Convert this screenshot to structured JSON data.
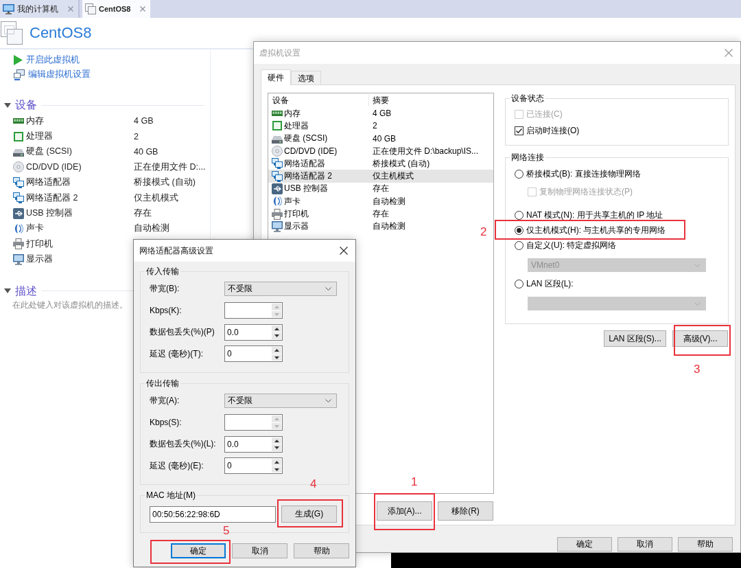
{
  "main_tabs": [
    {
      "kind": "computer",
      "label": "我的计算机",
      "selected": false
    },
    {
      "kind": "vm",
      "label": "CentOS8",
      "selected": true
    }
  ],
  "vm_page": {
    "title": "CentOS8",
    "actions": [
      {
        "kind": "power_on",
        "label": "开启此虚拟机"
      },
      {
        "kind": "edit",
        "label": "编辑虚拟机设置"
      }
    ],
    "devices": {
      "title": "设备",
      "expanded": true,
      "items": [
        {
          "kind": "memory",
          "name": "内存",
          "summary": "4 GB"
        },
        {
          "kind": "processor",
          "name": "处理器",
          "summary": "2"
        },
        {
          "kind": "disk",
          "name": "硬盘 (SCSI)",
          "summary": "40 GB"
        },
        {
          "kind": "cdrom",
          "name": "CD/DVD (IDE)",
          "summary": "正在使用文件 D:..."
        },
        {
          "kind": "network",
          "name": "网络适配器",
          "summary": "桥接模式 (自动)"
        },
        {
          "kind": "network",
          "name": "网络适配器 2",
          "summary": "仅主机模式"
        },
        {
          "kind": "usb",
          "name": "USB 控制器",
          "summary": "存在"
        },
        {
          "kind": "sound",
          "name": "声卡",
          "summary": "自动检测"
        },
        {
          "kind": "printer",
          "name": "打印机"
        },
        {
          "kind": "display",
          "name": "显示器"
        }
      ]
    },
    "description": {
      "title": "描述",
      "expanded": true,
      "text": "在此处键入对该虚拟机的描述。"
    }
  },
  "settings_dialog": {
    "title": "虚拟机设置",
    "active": false,
    "tabs": [
      {
        "label": "硬件",
        "selected": true
      },
      {
        "label": "选项",
        "selected": false
      }
    ],
    "device_table": {
      "columns": [
        "设备",
        "摘要"
      ],
      "rows": [
        {
          "kind": "memory",
          "device": "内存",
          "summary": "4 GB",
          "selected": false
        },
        {
          "kind": "processor",
          "device": "处理器",
          "summary": "2",
          "selected": false
        },
        {
          "kind": "disk",
          "device": "硬盘 (SCSI)",
          "summary": "40 GB",
          "selected": false
        },
        {
          "kind": "cdrom",
          "device": "CD/DVD (IDE)",
          "summary": "正在使用文件 D:\\backup\\IS...",
          "selected": false
        },
        {
          "kind": "network",
          "device": "网络适配器",
          "summary": "桥接模式 (自动)",
          "selected": false
        },
        {
          "kind": "network",
          "device": "网络适配器 2",
          "summary": "仅主机模式",
          "selected": true
        },
        {
          "kind": "usb",
          "device": "USB 控制器",
          "summary": "存在",
          "selected": false
        },
        {
          "kind": "sound",
          "device": "声卡",
          "summary": "自动检测",
          "selected": false
        },
        {
          "kind": "printer",
          "device": "打印机",
          "summary": "存在",
          "selected": false
        },
        {
          "kind": "display",
          "device": "显示器",
          "summary": "自动检测",
          "selected": false
        }
      ]
    },
    "table_buttons": [
      {
        "label": "添加(A)...",
        "annotation": "1"
      },
      {
        "label": "移除(R)"
      }
    ],
    "device_status": {
      "title": "设备状态",
      "options": [
        {
          "label": "已连接(C)",
          "checked": false,
          "disabled": true
        },
        {
          "label": "启动时连接(O)",
          "checked": true,
          "disabled": false
        }
      ]
    },
    "network_connection": {
      "title": "网络连接",
      "options": [
        {
          "kind": "radio",
          "label": "桥接模式(B): 直接连接物理网络",
          "selected": false,
          "disabled": false
        },
        {
          "kind": "checkbox",
          "label": "复制物理网络连接状态(P)",
          "checked": false,
          "disabled": true
        },
        {
          "kind": "radio",
          "label": "NAT 模式(N): 用于共享主机的 IP 地址",
          "selected": false,
          "disabled": false
        },
        {
          "kind": "radio",
          "label": "仅主机模式(H): 与主机共享的专用网络",
          "selected": true,
          "disabled": false,
          "annotation": "2"
        },
        {
          "kind": "radio",
          "label": "自定义(U): 特定虚拟网络",
          "selected": false,
          "disabled": false
        },
        {
          "kind": "dropdown",
          "value": "VMnet0",
          "disabled": true
        },
        {
          "kind": "radio",
          "label": "LAN 区段(L):",
          "selected": false,
          "disabled": false
        },
        {
          "kind": "dropdown",
          "disabled": true
        }
      ]
    },
    "network_buttons": [
      {
        "label": "LAN 区段(S)..."
      },
      {
        "label": "高级(V)...",
        "annotation": "3"
      }
    ],
    "buttons": [
      {
        "label": "确定"
      },
      {
        "label": "取消"
      },
      {
        "label": "帮助"
      }
    ]
  },
  "advanced_dialog": {
    "title": "网络适配器高级设置",
    "active": true,
    "groups": [
      {
        "title": "传入传输",
        "rows": [
          {
            "kind": "dropdown",
            "label": "带宽(B):",
            "value": "不受限",
            "disabled": false
          },
          {
            "kind": "spin",
            "label": "Kbps(K):",
            "disabled": true
          },
          {
            "kind": "spin",
            "label": "数据包丢失(%)(P)",
            "value": "0.0",
            "disabled": false
          },
          {
            "kind": "spin",
            "label": "延迟 (毫秒)(T):",
            "value": "0",
            "disabled": false
          }
        ]
      },
      {
        "title": "传出传输",
        "rows": [
          {
            "kind": "dropdown",
            "label": "带宽(A):",
            "value": "不受限",
            "disabled": false
          },
          {
            "kind": "spin",
            "label": "Kbps(S):",
            "disabled": true
          },
          {
            "kind": "spin",
            "label": "数据包丢失(%)(L):",
            "value": "0.0",
            "disabled": false
          },
          {
            "kind": "spin",
            "label": "延迟 (毫秒)(E):",
            "value": "0",
            "disabled": false
          }
        ]
      }
    ],
    "mac": {
      "title": "MAC 地址(M)",
      "value": "00:50:56:22:98:6D",
      "button": {
        "label": "生成(G)",
        "annotation": "4"
      }
    },
    "buttons": [
      {
        "label": "确定",
        "focused": true,
        "annotation": "5"
      },
      {
        "label": "取消",
        "focused": false
      },
      {
        "label": "帮助",
        "focused": false
      }
    ]
  }
}
